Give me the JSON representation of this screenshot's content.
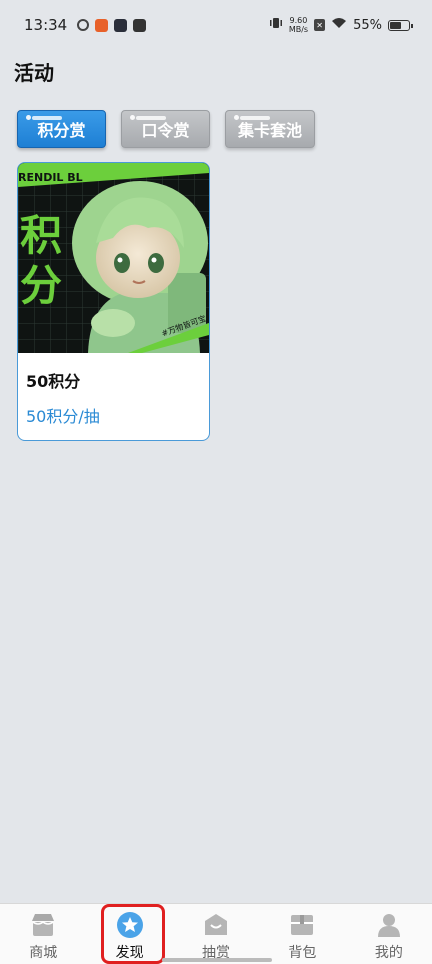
{
  "status_bar": {
    "time": "13:34",
    "net_speed_value": "9.60",
    "net_speed_unit": "MB/s",
    "battery": "55%"
  },
  "page": {
    "title": "活动"
  },
  "tabs": [
    {
      "label": "积分赏",
      "active": true
    },
    {
      "label": "口令赏",
      "active": false
    },
    {
      "label": "集卡套池",
      "active": false
    }
  ],
  "cards": [
    {
      "art_big_text_1": "积",
      "art_big_text_2": "分",
      "art_tag": "#万物皆可宝",
      "art_brand": "RENDIL BL",
      "name": "50积分",
      "price": "50积分/抽"
    }
  ],
  "bottom_nav": [
    {
      "label": "商城",
      "icon": "shop-icon"
    },
    {
      "label": "发现",
      "icon": "star-icon",
      "active": true
    },
    {
      "label": "抽赏",
      "icon": "bag-icon"
    },
    {
      "label": "背包",
      "icon": "box-icon"
    },
    {
      "label": "我的",
      "icon": "user-icon"
    }
  ],
  "colors": {
    "accent": "#1e7fd4",
    "highlight": "#e02020",
    "price": "#2a8ad4"
  }
}
